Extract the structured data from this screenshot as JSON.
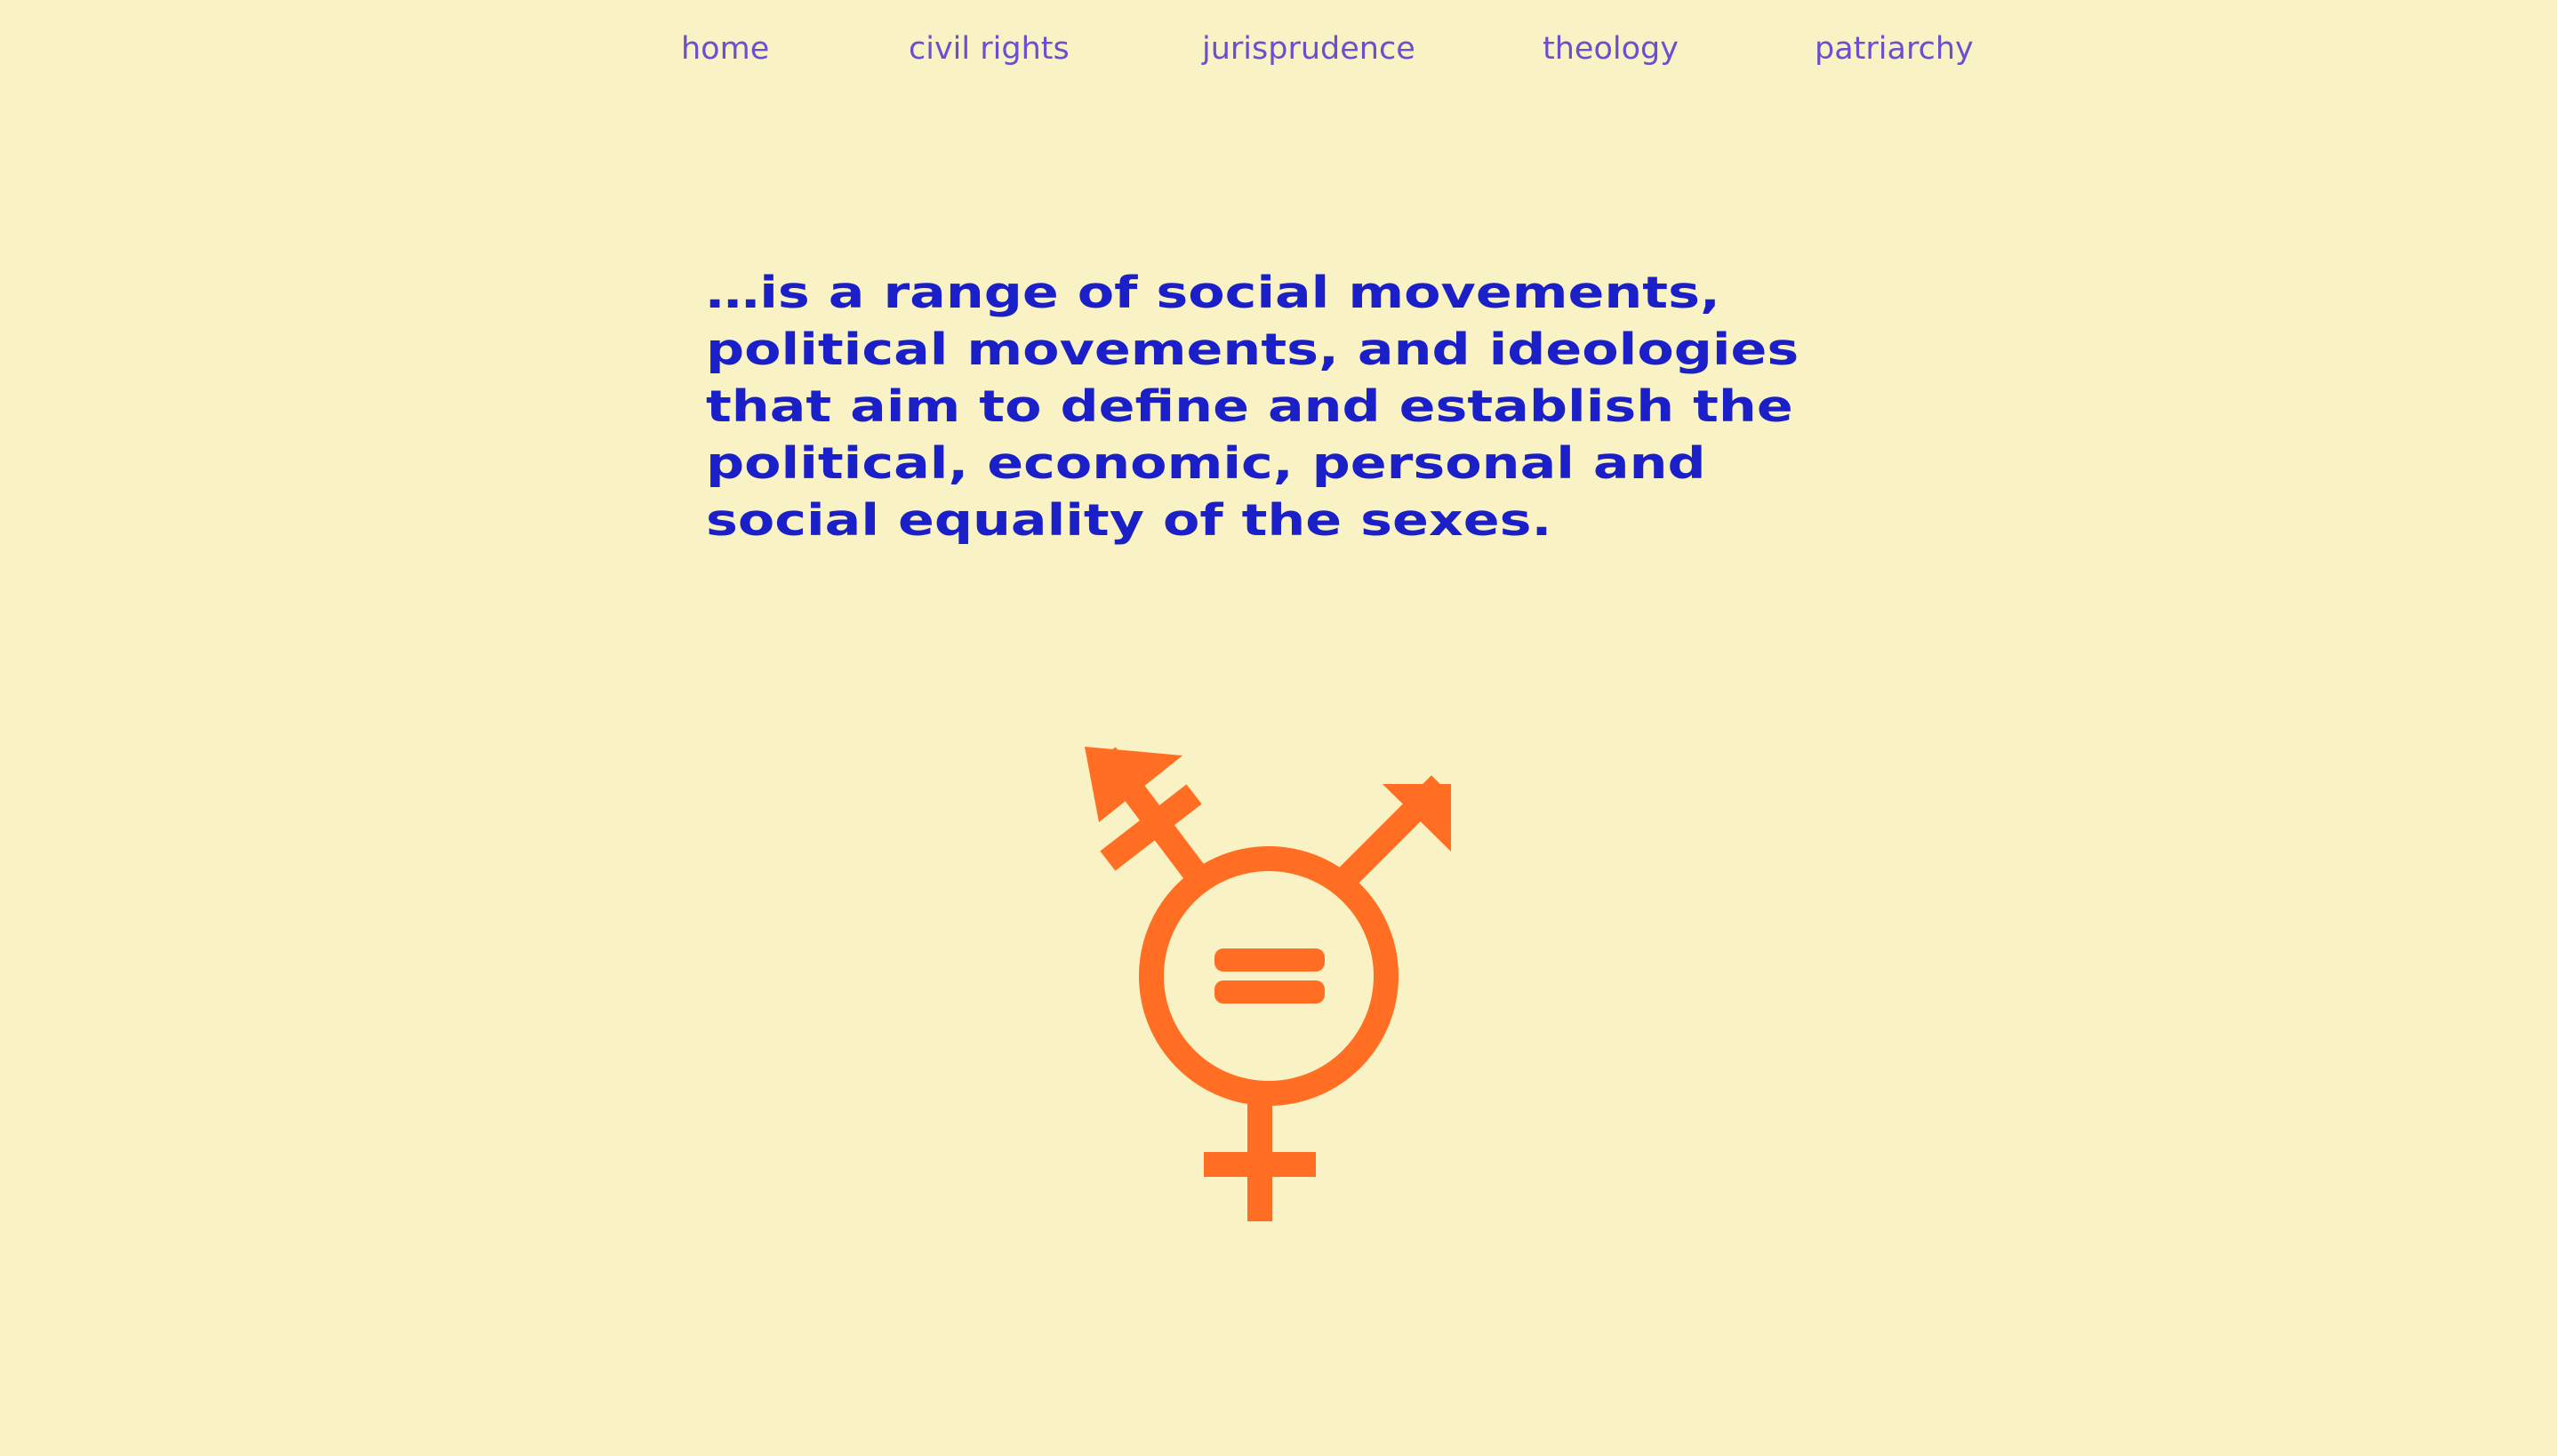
{
  "nav": {
    "items": [
      {
        "label": "home"
      },
      {
        "label": "civil rights"
      },
      {
        "label": "jurisprudence"
      },
      {
        "label": "theology"
      },
      {
        "label": "patriarchy"
      }
    ]
  },
  "main": {
    "definition_lines": [
      "…is a range of social movements,",
      "political movements, and ideologies",
      "that aim to define and establish the",
      "political, economic, personal and",
      "social equality of the sexes."
    ]
  },
  "symbol": {
    "icon": "gender-equality-symbol-icon",
    "color": "#ff6e22"
  },
  "colors": {
    "background": "#f8f2c5",
    "nav_text": "#6b4fd0",
    "headline_text": "#1a1fc7"
  }
}
